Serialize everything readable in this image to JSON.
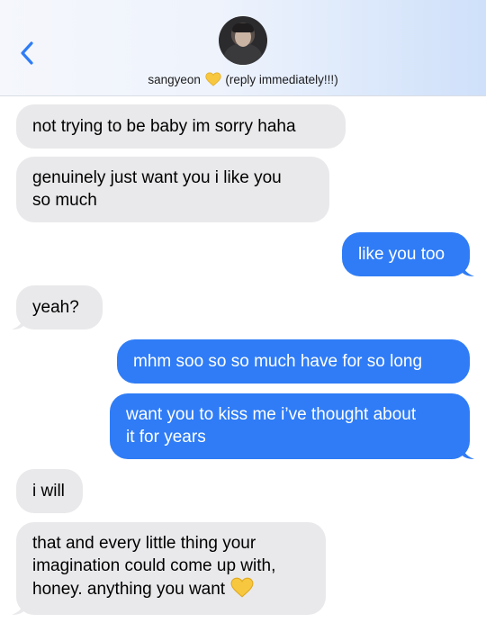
{
  "header": {
    "contact_name": "sangyeon",
    "contact_suffix": "(reply immediately!!!)",
    "heart_icon": "yellow-heart-icon",
    "back_icon": "chevron-left-icon",
    "colors": {
      "accent": "#2f7cf6",
      "incoming": "#e9e9eb",
      "heart": "#f7c83f"
    }
  },
  "messages": [
    {
      "dir": "in",
      "text": "not trying to be baby im sorry haha"
    },
    {
      "dir": "in",
      "text": "genuinely just want you i like you\nso much"
    },
    {
      "dir": "out",
      "text": "like you too"
    },
    {
      "dir": "in",
      "text": "yeah?"
    },
    {
      "dir": "out",
      "text": "mhm soo so so much have for so long"
    },
    {
      "dir": "out",
      "text": "want you to kiss me i’ve thought about\nit for years"
    },
    {
      "dir": "in",
      "text": "i will"
    },
    {
      "dir": "in",
      "text": "that and every little thing your\nimagination could come up with,\nhoney. anything you want",
      "trailing_icon": "yellow-heart-icon"
    }
  ]
}
